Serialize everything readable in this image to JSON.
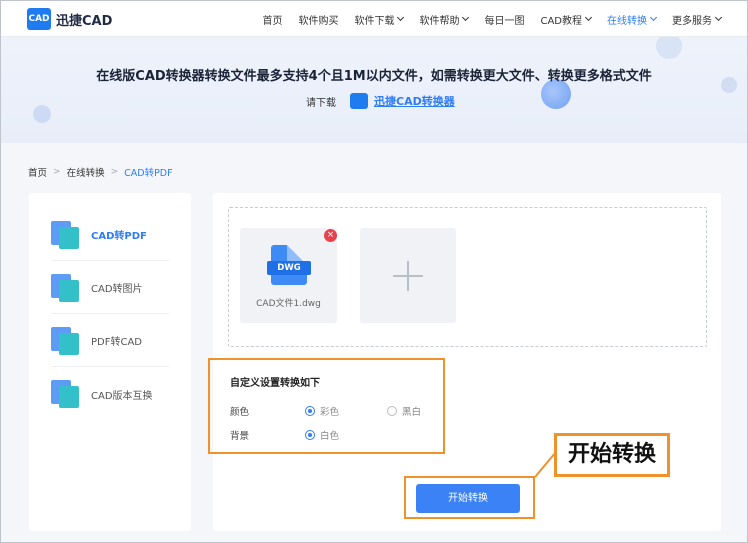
{
  "header": {
    "logo_badge": "CAD",
    "logo_text": "迅捷CAD",
    "nav": [
      {
        "label": "首页",
        "dropdown": false,
        "active": false
      },
      {
        "label": "软件购买",
        "dropdown": false,
        "active": false
      },
      {
        "label": "软件下载",
        "dropdown": true,
        "active": false
      },
      {
        "label": "软件帮助",
        "dropdown": true,
        "active": false
      },
      {
        "label": "每日一图",
        "dropdown": false,
        "active": false
      },
      {
        "label": "CAD教程",
        "dropdown": true,
        "active": false
      },
      {
        "label": "在线转换",
        "dropdown": true,
        "active": true
      },
      {
        "label": "更多服务",
        "dropdown": true,
        "active": false
      }
    ]
  },
  "banner": {
    "title": "在线版CAD转换器转换文件最多支持4个且1M以内文件，如需转换更大文件、转换更多格式文件",
    "download_prefix": "请下载",
    "download_link": "迅捷CAD转换器"
  },
  "breadcrumb": {
    "home": "首页",
    "section": "在线转换",
    "current": "CAD转PDF"
  },
  "sidebar": {
    "items": [
      {
        "label": "CAD转PDF",
        "active": true
      },
      {
        "label": "CAD转图片",
        "active": false
      },
      {
        "label": "PDF转CAD",
        "active": false
      },
      {
        "label": "CAD版本互换",
        "active": false
      }
    ]
  },
  "upload": {
    "file_type_tag": "DWG",
    "file_name": "CAD文件1.dwg",
    "remove_symbol": "×",
    "add_symbol": "+"
  },
  "settings": {
    "title": "自定义设置转换如下",
    "color_label": "颜色",
    "color_options": [
      "彩色",
      "黑白"
    ],
    "color_selected": "彩色",
    "background_label": "背景",
    "background_options": [
      "白色"
    ],
    "background_selected": "白色"
  },
  "actions": {
    "start_label": "开始转换",
    "callout_label": "开始转换"
  },
  "colors": {
    "accent": "#2f7df6",
    "highlight": "#f0922b",
    "remove": "#e8414a"
  }
}
